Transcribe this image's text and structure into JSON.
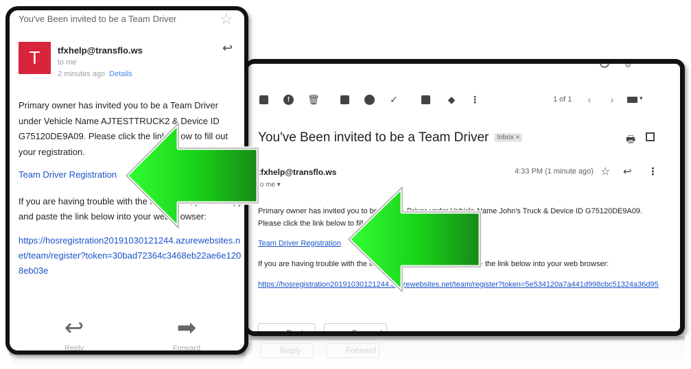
{
  "phone": {
    "subject": "You've Been invited to be a Team Driver",
    "avatar_letter": "T",
    "sender": "tfxhelp@transflo.ws",
    "to": "to me",
    "time": "2 minutes ago",
    "details": "Details",
    "body": "Primary owner has invited you to be a Team Driver under Vehicle Name AJTESTTRUCK2 & Device ID G75120DE9A09. Please click the link below to fill out your registration.",
    "link_text": "Team Driver Registration",
    "trouble_text": "If you are having trouble with the link above, please copy and paste the link below into your web browser:",
    "url": "https://hosregistration20191030121244.azurewebsites.net/team/register?token=30bad72364c3468eb22ae6e1208eb03e",
    "reply_label": "Reply",
    "forward_label": "Forward"
  },
  "desktop": {
    "pager": "1 of 1",
    "subject": "You've Been invited to be a Team Driver",
    "inbox_badge": "Inbox ×",
    "sender": "tfxhelp@transflo.ws",
    "to": "to me ▾",
    "time": "4:33 PM (1 minute ago)",
    "body": "Primary owner has invited you to be a Team Driver under Vehicle Name John's Truck & Device ID G75120DE9A09. Please click the link below to fill out your registration.",
    "link_text": "Team Driver Registration",
    "trouble_text": "If you are having trouble with the link above, please copy and paste the link below into your web browser:",
    "url": "https://hosregistration20191030121244.azurewebsites.net/team/register?token=5e534120a7a441d998cbc51324a36d95",
    "reply_label": "Reply",
    "forward_label": "Forward"
  },
  "colors": {
    "arrow_green": "#22cc22",
    "avatar_red": "#d9253b",
    "link_blue": "#1a53c8"
  }
}
